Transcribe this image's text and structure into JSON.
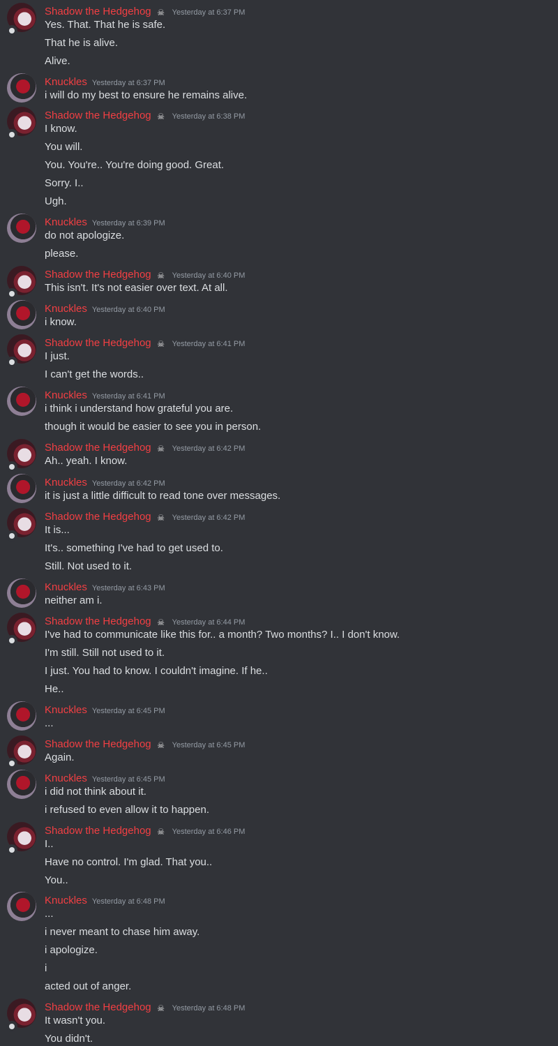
{
  "groups": [
    {
      "author": "Shadow the Hedgehog",
      "avatar": "shadow",
      "badge": "skull-crossbones-icon",
      "time": "Yesterday at 6:37 PM",
      "lines": [
        "Yes. That. That he is safe.",
        "That he is alive.",
        "Alive."
      ]
    },
    {
      "author": "Knuckles",
      "avatar": "knuckles",
      "time": "Yesterday at 6:37 PM",
      "lines": [
        "i will do my best to ensure he remains alive."
      ]
    },
    {
      "author": "Shadow the Hedgehog",
      "avatar": "shadow",
      "badge": "skull-crossbones-icon",
      "time": "Yesterday at 6:38 PM",
      "lines": [
        "I know.",
        "You will.",
        "You. You're.. You're doing good. Great.",
        "Sorry. I..",
        "Ugh."
      ]
    },
    {
      "author": "Knuckles",
      "avatar": "knuckles",
      "time": "Yesterday at 6:39 PM",
      "lines": [
        "do not apologize.",
        "please."
      ]
    },
    {
      "author": "Shadow the Hedgehog",
      "avatar": "shadow",
      "badge": "skull-crossbones-icon",
      "time": "Yesterday at 6:40 PM",
      "lines": [
        "This isn't. It's not easier over text. At all."
      ]
    },
    {
      "author": "Knuckles",
      "avatar": "knuckles",
      "time": "Yesterday at 6:40 PM",
      "lines": [
        "i know."
      ]
    },
    {
      "author": "Shadow the Hedgehog",
      "avatar": "shadow",
      "badge": "skull-crossbones-icon",
      "time": "Yesterday at 6:41 PM",
      "lines": [
        "I just.",
        "I can't get the words.."
      ]
    },
    {
      "author": "Knuckles",
      "avatar": "knuckles",
      "time": "Yesterday at 6:41 PM",
      "lines": [
        "i think i understand how grateful you are.",
        "though it would be easier to see you in person."
      ]
    },
    {
      "author": "Shadow the Hedgehog",
      "avatar": "shadow",
      "badge": "skull-crossbones-icon",
      "time": "Yesterday at 6:42 PM",
      "lines": [
        "Ah.. yeah. I know."
      ]
    },
    {
      "author": "Knuckles",
      "avatar": "knuckles",
      "time": "Yesterday at 6:42 PM",
      "lines": [
        "it is just a little difficult to read tone over messages."
      ]
    },
    {
      "author": "Shadow the Hedgehog",
      "avatar": "shadow",
      "badge": "skull-crossbones-icon",
      "time": "Yesterday at 6:42 PM",
      "lines": [
        "It is...",
        "It's.. something I've had to get used to.",
        "Still. Not used to it."
      ]
    },
    {
      "author": "Knuckles",
      "avatar": "knuckles",
      "time": "Yesterday at 6:43 PM",
      "lines": [
        "neither am i."
      ]
    },
    {
      "author": "Shadow the Hedgehog",
      "avatar": "shadow",
      "badge": "skull-crossbones-icon",
      "time": "Yesterday at 6:44 PM",
      "lines": [
        "I've had to communicate like this for.. a month? Two months? I.. I don't know.",
        "I'm still. Still not used to it.",
        "I just. You had to know. I couldn't imagine. If he..",
        "He.."
      ]
    },
    {
      "author": "Knuckles",
      "avatar": "knuckles",
      "time": "Yesterday at 6:45 PM",
      "lines": [
        "..."
      ]
    },
    {
      "author": "Shadow the Hedgehog",
      "avatar": "shadow",
      "badge": "skull-crossbones-icon",
      "time": "Yesterday at 6:45 PM",
      "lines": [
        "Again."
      ]
    },
    {
      "author": "Knuckles",
      "avatar": "knuckles",
      "time": "Yesterday at 6:45 PM",
      "lines": [
        "i did not think about it.",
        "i refused to even allow it to happen."
      ]
    },
    {
      "author": "Shadow the Hedgehog",
      "avatar": "shadow",
      "badge": "skull-crossbones-icon",
      "time": "Yesterday at 6:46 PM",
      "lines": [
        "I..",
        "Have no control. I'm glad. That you..",
        "You.."
      ]
    },
    {
      "author": "Knuckles",
      "avatar": "knuckles",
      "time": "Yesterday at 6:48 PM",
      "lines": [
        "...",
        "i never meant to chase him away.",
        "i apologize.",
        "i",
        "acted out of anger."
      ]
    },
    {
      "author": "Shadow the Hedgehog",
      "avatar": "shadow",
      "badge": "skull-crossbones-icon",
      "time": "Yesterday at 6:48 PM",
      "lines": [
        "It wasn't you.",
        "You didn't."
      ]
    }
  ]
}
